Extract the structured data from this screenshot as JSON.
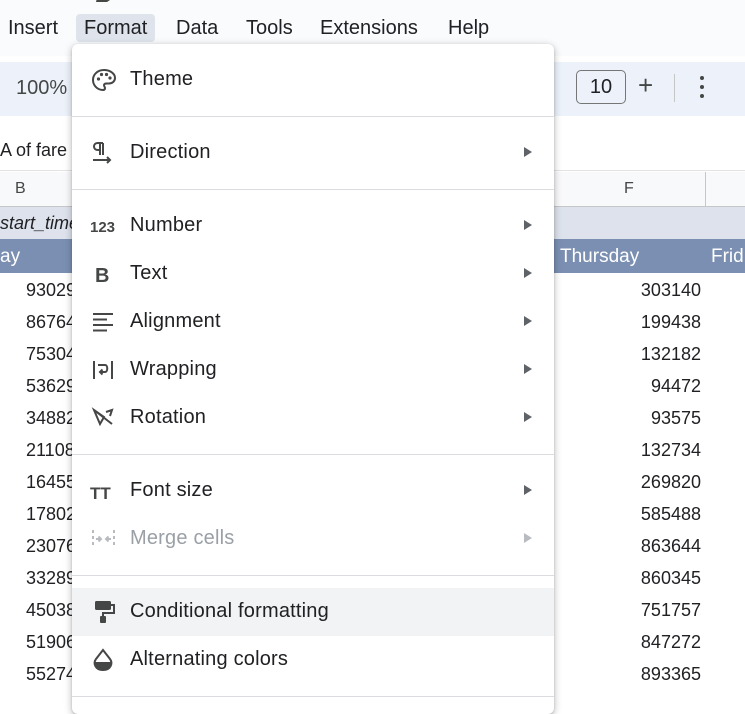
{
  "menubar": {
    "items": [
      "Insert",
      "Format",
      "Data",
      "Tools",
      "Extensions",
      "Help"
    ],
    "active": "Format"
  },
  "toolbar": {
    "zoom": "100%",
    "font_size": "10",
    "minus": "-",
    "plus": "+"
  },
  "formula_bar": {
    "text": "A of fare"
  },
  "columns": {
    "b": "B",
    "f": "F"
  },
  "sheet": {
    "start_time_label": "start_time",
    "day_left": "ay",
    "day_thursday": "Thursday",
    "day_friday": "Frid",
    "col_b_values": [
      "93029",
      "86764",
      "75304",
      "53629",
      "34882",
      "21108",
      "16455",
      "17802",
      "23076",
      "33289",
      "45038",
      "51906",
      "55274"
    ],
    "col_f_values": [
      "303140",
      "199438",
      "132182",
      "94472",
      "93575",
      "132734",
      "269820",
      "585488",
      "863644",
      "860345",
      "751757",
      "847272",
      "893365"
    ]
  },
  "format_menu": {
    "theme": "Theme",
    "direction": "Direction",
    "number": "Number",
    "text": "Text",
    "alignment": "Alignment",
    "wrapping": "Wrapping",
    "rotation": "Rotation",
    "font_size": "Font size",
    "merge_cells": "Merge cells",
    "conditional_formatting": "Conditional formatting",
    "alternating_colors": "Alternating colors",
    "number_icon_text": "123",
    "text_icon_text": "B",
    "font_size_icon_text": "TT"
  },
  "colors": {
    "menubar_bg": "#f9fbfd",
    "toolbar_bg": "#edf2fa",
    "active_menu_bg": "#dfe4ec",
    "header_row_bg": "#7b8fb2",
    "subheader_row_bg": "#dde2ec",
    "hover_bg": "#f1f3f4"
  }
}
